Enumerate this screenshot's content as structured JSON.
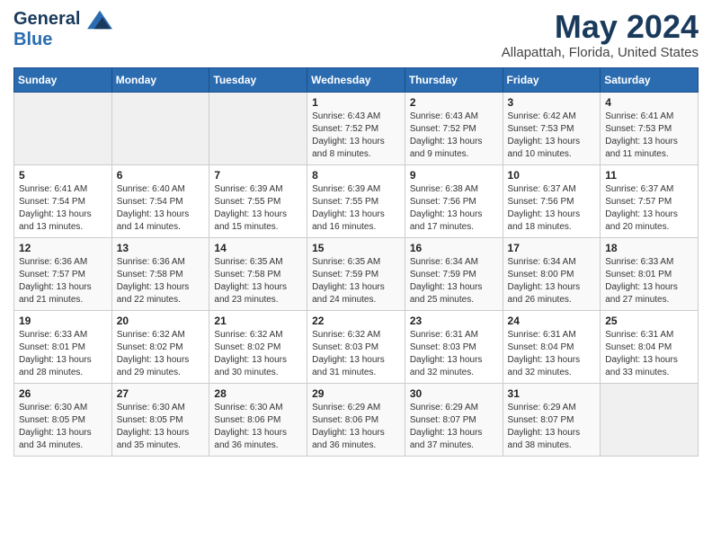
{
  "header": {
    "logo_line1": "General",
    "logo_line2": "Blue",
    "title": "May 2024",
    "subtitle": "Allapattah, Florida, United States"
  },
  "days_of_week": [
    "Sunday",
    "Monday",
    "Tuesday",
    "Wednesday",
    "Thursday",
    "Friday",
    "Saturday"
  ],
  "weeks": [
    [
      {
        "day": "",
        "info": ""
      },
      {
        "day": "",
        "info": ""
      },
      {
        "day": "",
        "info": ""
      },
      {
        "day": "1",
        "info": "Sunrise: 6:43 AM\nSunset: 7:52 PM\nDaylight: 13 hours\nand 8 minutes."
      },
      {
        "day": "2",
        "info": "Sunrise: 6:43 AM\nSunset: 7:52 PM\nDaylight: 13 hours\nand 9 minutes."
      },
      {
        "day": "3",
        "info": "Sunrise: 6:42 AM\nSunset: 7:53 PM\nDaylight: 13 hours\nand 10 minutes."
      },
      {
        "day": "4",
        "info": "Sunrise: 6:41 AM\nSunset: 7:53 PM\nDaylight: 13 hours\nand 11 minutes."
      }
    ],
    [
      {
        "day": "5",
        "info": "Sunrise: 6:41 AM\nSunset: 7:54 PM\nDaylight: 13 hours\nand 13 minutes."
      },
      {
        "day": "6",
        "info": "Sunrise: 6:40 AM\nSunset: 7:54 PM\nDaylight: 13 hours\nand 14 minutes."
      },
      {
        "day": "7",
        "info": "Sunrise: 6:39 AM\nSunset: 7:55 PM\nDaylight: 13 hours\nand 15 minutes."
      },
      {
        "day": "8",
        "info": "Sunrise: 6:39 AM\nSunset: 7:55 PM\nDaylight: 13 hours\nand 16 minutes."
      },
      {
        "day": "9",
        "info": "Sunrise: 6:38 AM\nSunset: 7:56 PM\nDaylight: 13 hours\nand 17 minutes."
      },
      {
        "day": "10",
        "info": "Sunrise: 6:37 AM\nSunset: 7:56 PM\nDaylight: 13 hours\nand 18 minutes."
      },
      {
        "day": "11",
        "info": "Sunrise: 6:37 AM\nSunset: 7:57 PM\nDaylight: 13 hours\nand 20 minutes."
      }
    ],
    [
      {
        "day": "12",
        "info": "Sunrise: 6:36 AM\nSunset: 7:57 PM\nDaylight: 13 hours\nand 21 minutes."
      },
      {
        "day": "13",
        "info": "Sunrise: 6:36 AM\nSunset: 7:58 PM\nDaylight: 13 hours\nand 22 minutes."
      },
      {
        "day": "14",
        "info": "Sunrise: 6:35 AM\nSunset: 7:58 PM\nDaylight: 13 hours\nand 23 minutes."
      },
      {
        "day": "15",
        "info": "Sunrise: 6:35 AM\nSunset: 7:59 PM\nDaylight: 13 hours\nand 24 minutes."
      },
      {
        "day": "16",
        "info": "Sunrise: 6:34 AM\nSunset: 7:59 PM\nDaylight: 13 hours\nand 25 minutes."
      },
      {
        "day": "17",
        "info": "Sunrise: 6:34 AM\nSunset: 8:00 PM\nDaylight: 13 hours\nand 26 minutes."
      },
      {
        "day": "18",
        "info": "Sunrise: 6:33 AM\nSunset: 8:01 PM\nDaylight: 13 hours\nand 27 minutes."
      }
    ],
    [
      {
        "day": "19",
        "info": "Sunrise: 6:33 AM\nSunset: 8:01 PM\nDaylight: 13 hours\nand 28 minutes."
      },
      {
        "day": "20",
        "info": "Sunrise: 6:32 AM\nSunset: 8:02 PM\nDaylight: 13 hours\nand 29 minutes."
      },
      {
        "day": "21",
        "info": "Sunrise: 6:32 AM\nSunset: 8:02 PM\nDaylight: 13 hours\nand 30 minutes."
      },
      {
        "day": "22",
        "info": "Sunrise: 6:32 AM\nSunset: 8:03 PM\nDaylight: 13 hours\nand 31 minutes."
      },
      {
        "day": "23",
        "info": "Sunrise: 6:31 AM\nSunset: 8:03 PM\nDaylight: 13 hours\nand 32 minutes."
      },
      {
        "day": "24",
        "info": "Sunrise: 6:31 AM\nSunset: 8:04 PM\nDaylight: 13 hours\nand 32 minutes."
      },
      {
        "day": "25",
        "info": "Sunrise: 6:31 AM\nSunset: 8:04 PM\nDaylight: 13 hours\nand 33 minutes."
      }
    ],
    [
      {
        "day": "26",
        "info": "Sunrise: 6:30 AM\nSunset: 8:05 PM\nDaylight: 13 hours\nand 34 minutes."
      },
      {
        "day": "27",
        "info": "Sunrise: 6:30 AM\nSunset: 8:05 PM\nDaylight: 13 hours\nand 35 minutes."
      },
      {
        "day": "28",
        "info": "Sunrise: 6:30 AM\nSunset: 8:06 PM\nDaylight: 13 hours\nand 36 minutes."
      },
      {
        "day": "29",
        "info": "Sunrise: 6:29 AM\nSunset: 8:06 PM\nDaylight: 13 hours\nand 36 minutes."
      },
      {
        "day": "30",
        "info": "Sunrise: 6:29 AM\nSunset: 8:07 PM\nDaylight: 13 hours\nand 37 minutes."
      },
      {
        "day": "31",
        "info": "Sunrise: 6:29 AM\nSunset: 8:07 PM\nDaylight: 13 hours\nand 38 minutes."
      },
      {
        "day": "",
        "info": ""
      }
    ]
  ]
}
